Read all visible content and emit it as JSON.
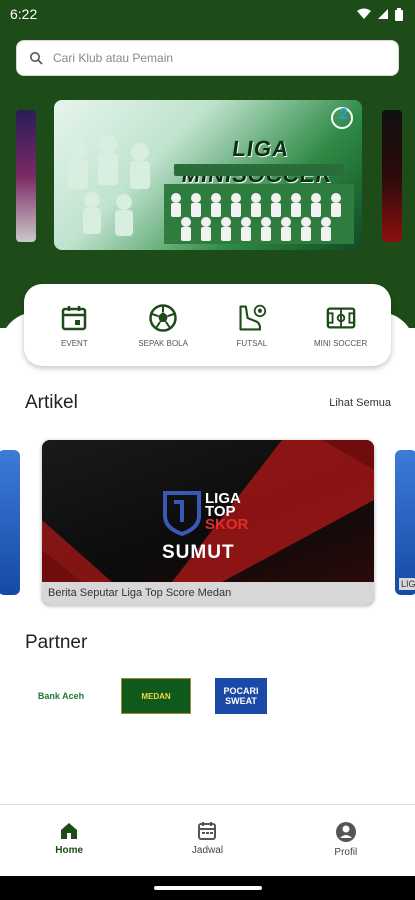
{
  "status_bar": {
    "time": "6:22"
  },
  "search": {
    "placeholder": "Cari Klub atau Pemain"
  },
  "banner": {
    "title": "LIGA MINISOCCER",
    "badge": "2"
  },
  "categories": [
    {
      "label": "EVENT",
      "icon": "calendar-icon"
    },
    {
      "label": "SEPAK BOLA",
      "icon": "soccer-ball-icon"
    },
    {
      "label": "FUTSAL",
      "icon": "futsal-shoe-icon"
    },
    {
      "label": "MINI SOCCER",
      "icon": "field-icon"
    }
  ],
  "articles": {
    "title": "Artikel",
    "see_all": "Lihat Semua",
    "items": [
      {
        "caption": "Berita Seputar Liga Top Score Medan",
        "logo_line1": "LIGA",
        "logo_line2": "TOP",
        "logo_line3": "SKOR",
        "logo_line4": "SUMUT"
      }
    ],
    "side_caption": "LIG"
  },
  "partners": {
    "title": "Partner",
    "items": [
      {
        "name": "Bank Aceh"
      },
      {
        "name": "MEDAN"
      },
      {
        "name": "POCARI SWEAT"
      }
    ]
  },
  "nav": [
    {
      "label": "Home",
      "icon": "home-icon",
      "active": true
    },
    {
      "label": "Jadwal",
      "icon": "calendar-icon",
      "active": false
    },
    {
      "label": "Profil",
      "icon": "profile-icon",
      "active": false
    }
  ],
  "colors": {
    "primary": "#1e4c19",
    "accent_red": "#e12c2c"
  }
}
